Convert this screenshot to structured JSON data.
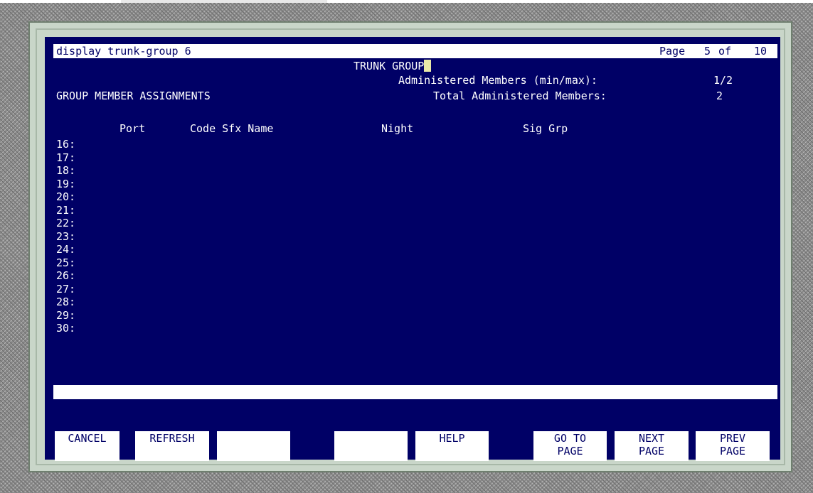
{
  "screen": {
    "command": "display trunk-group 6",
    "page_label": "Page",
    "page_current": "5",
    "page_of": "of",
    "page_total": "10",
    "title": "TRUNK GROUP",
    "admin_members_label": "Administered Members (min/max):",
    "admin_members_value": "1/2",
    "section_title": "GROUP MEMBER ASSIGNMENTS",
    "total_members_label": "Total Administered Members:",
    "total_members_value": "2"
  },
  "table": {
    "headers": {
      "port": "Port",
      "code_sfx_name": "Code Sfx Name",
      "night": "Night",
      "sig_grp": "Sig Grp"
    },
    "rows": [
      "16:",
      "17:",
      "18:",
      "19:",
      "20:",
      "21:",
      "22:",
      "23:",
      "24:",
      "25:",
      "26:",
      "27:",
      "28:",
      "29:",
      "30:"
    ]
  },
  "function_keys": {
    "cancel": "CANCEL",
    "refresh": "REFRESH",
    "blank1": "",
    "blank2": "",
    "help": "HELP",
    "goto_line1": "GO TO",
    "goto_line2": "PAGE",
    "next_line1": "NEXT",
    "next_line2": "PAGE",
    "prev_line1": "PREV",
    "prev_line2": "PAGE"
  },
  "colors": {
    "screen_bg": "#000066",
    "text": "#ffffff",
    "cursor": "#e8e8a8"
  }
}
